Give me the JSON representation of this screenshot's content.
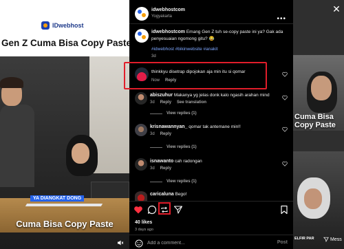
{
  "media": {
    "brand": "IDwebhost",
    "headline": "Gen Z Cuma Bisa Copy Paste",
    "caption_tag": "YA DIANGKAT DONG",
    "big_caption": "Cuma Bisa Copy Paste"
  },
  "next_reel": {
    "overlay_text": "Cuma Bisa Copy Paste",
    "tag": "ELFIR PAR",
    "send_label": "Mess"
  },
  "post": {
    "author": "idwebhostcom",
    "location": "Yogyakarta",
    "caption_author": "idwebhostcom",
    "caption_text": "Emang Gen Z tuh se-copy paste ini ya? Gak ada penyesuaian ngomong gitu? 😂",
    "hashtags": "#idwebhost #bikinwebsite #anakit",
    "caption_age": "3d"
  },
  "comments": [
    {
      "username": "",
      "text": "thinkkyu disetrap dipojokan aja min itu si qomar",
      "age": "Now",
      "reply_label": "Reply",
      "highlighted": true
    },
    {
      "username": "abiszuhur",
      "text": "Makanya yg jelas donk kalo ngasih arahan mind",
      "age": "3d",
      "reply_label": "Reply",
      "see_translation": "See translation",
      "view_replies": "View replies (1)"
    },
    {
      "username": "krisnawannyan_",
      "text": "qomar tak antemane min!!",
      "age": "3d",
      "reply_label": "Reply",
      "view_replies": "View replies (1)"
    },
    {
      "username": "isnawanto",
      "text": "cah radongan",
      "age": "3d",
      "reply_label": "Reply",
      "view_replies": "View replies (1)"
    },
    {
      "username": "caricaluna",
      "text": "Bego!",
      "age": "",
      "reply_label": ""
    }
  ],
  "actions": {
    "likes": "40 likes",
    "ago": "3 days ago"
  },
  "composer": {
    "placeholder": "Add a comment...",
    "post_label": "Post"
  },
  "colors": {
    "highlight": "#e11d2a",
    "hashtag": "#7ea7ff",
    "like": "#ff3040"
  }
}
